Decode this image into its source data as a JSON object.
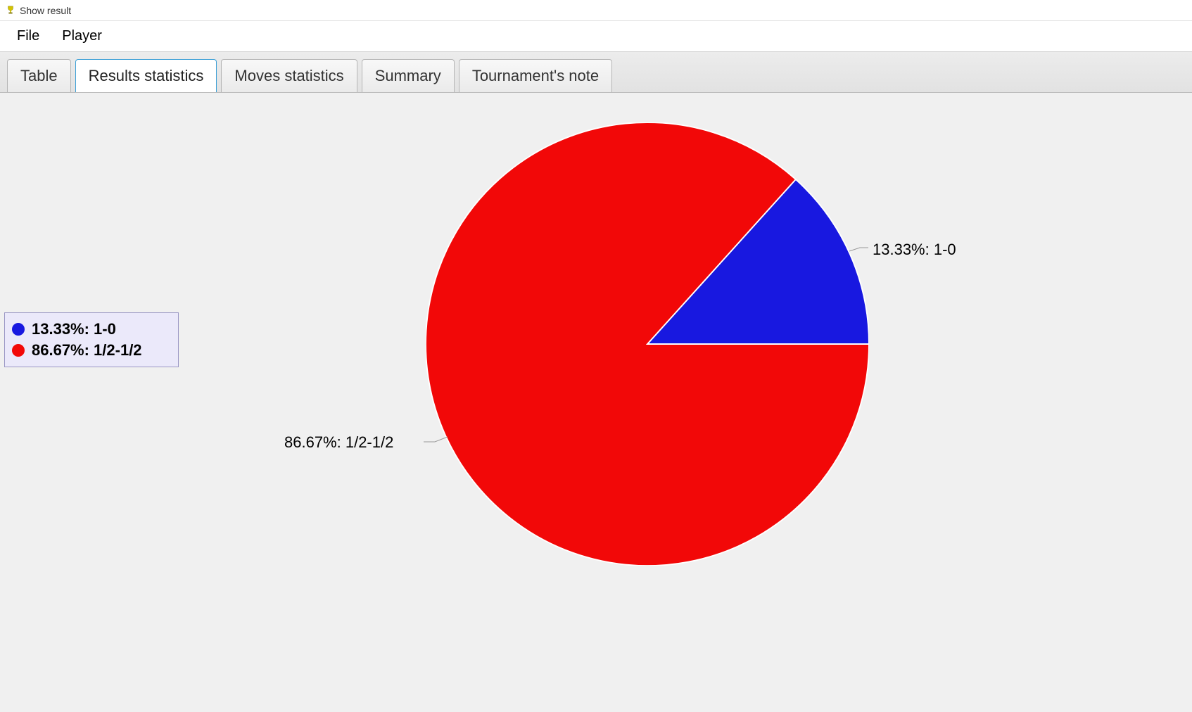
{
  "window": {
    "title": "Show result"
  },
  "menu": {
    "items": [
      "File",
      "Player"
    ]
  },
  "tabs": [
    {
      "label": "Table",
      "active": false
    },
    {
      "label": "Results statistics",
      "active": true
    },
    {
      "label": "Moves statistics",
      "active": false
    },
    {
      "label": "Summary",
      "active": false
    },
    {
      "label": "Tournament's note",
      "active": false
    }
  ],
  "legend": {
    "items": [
      {
        "swatch": "#1818e0",
        "text": "13.33%:  1-0"
      },
      {
        "swatch": "#f20808",
        "text": "86.67%:  1/2-1/2"
      }
    ]
  },
  "callouts": {
    "right": "13.33%:   1-0",
    "left": "86.67%:   1/2-1/2"
  },
  "chart_data": {
    "type": "pie",
    "title": "",
    "series": [
      {
        "name": "1-0",
        "value": 13.33,
        "color": "#1818e0"
      },
      {
        "name": "1/2-1/2",
        "value": 86.67,
        "color": "#f20808"
      }
    ]
  }
}
